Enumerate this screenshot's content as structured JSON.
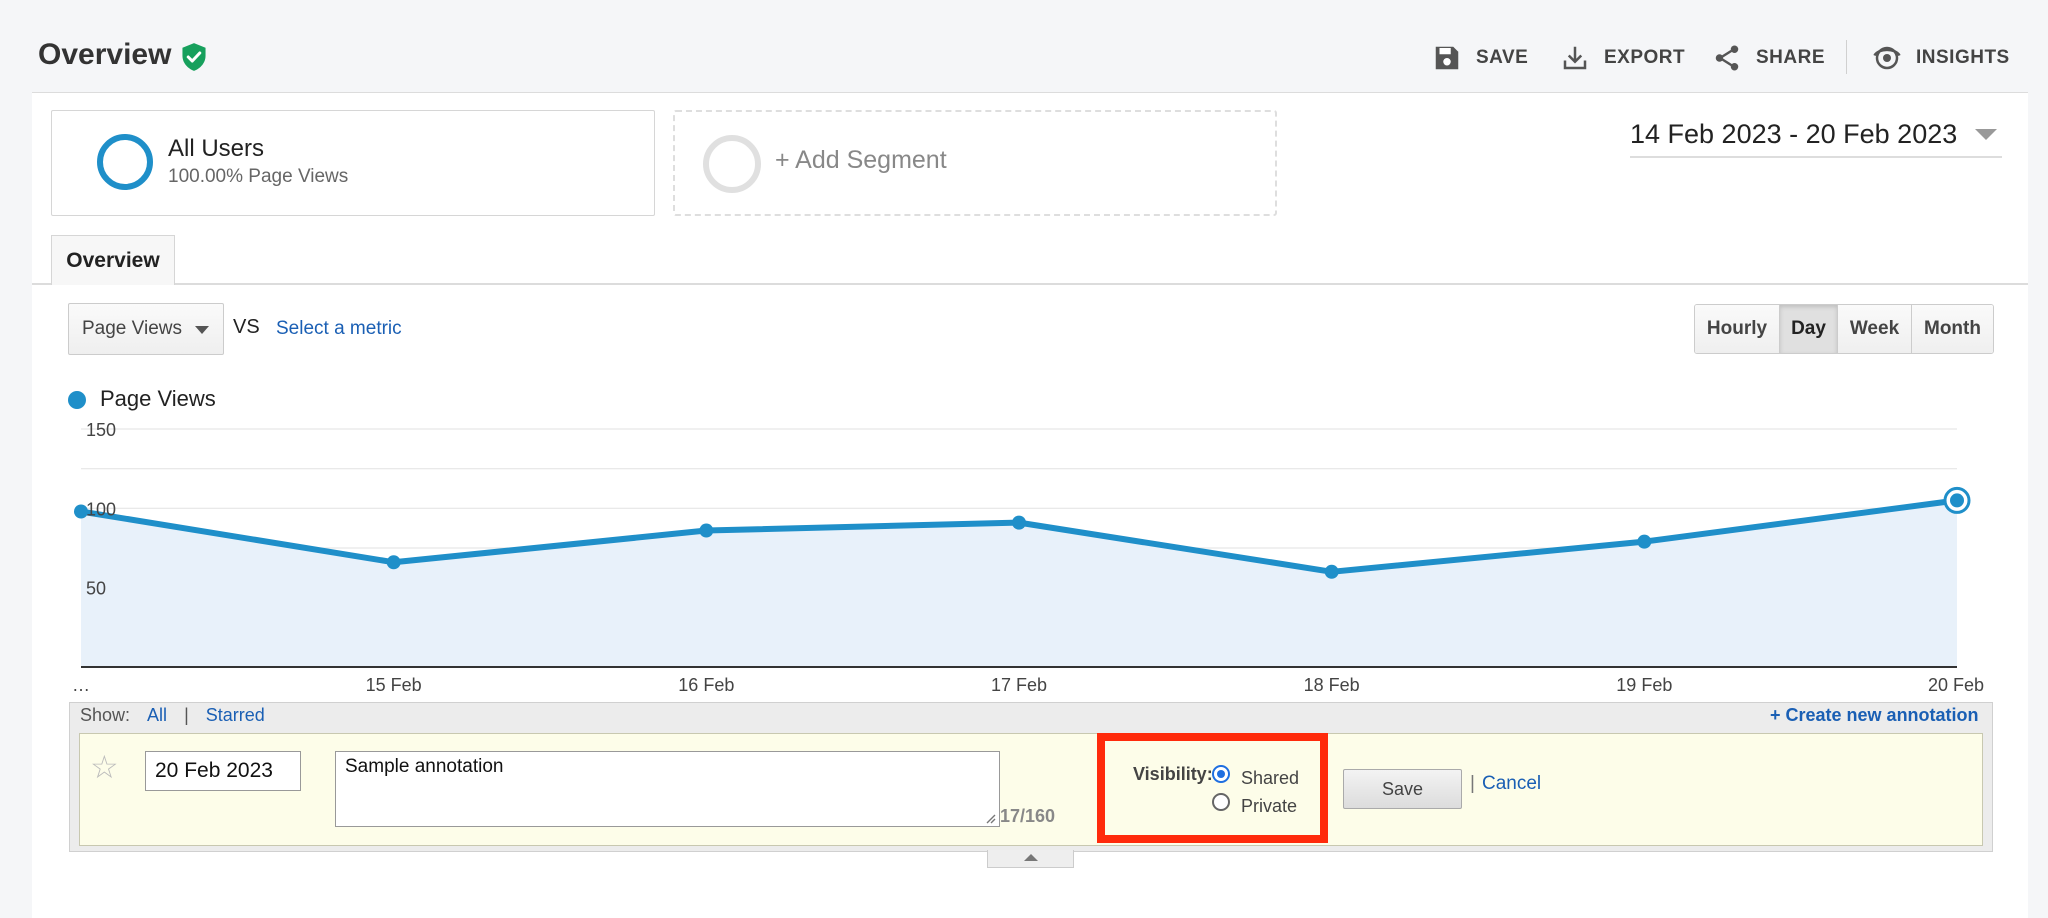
{
  "header": {
    "title": "Overview",
    "actions": {
      "save": "SAVE",
      "export": "EXPORT",
      "share": "SHARE",
      "insights": "INSIGHTS"
    }
  },
  "segments": {
    "active": {
      "name": "All Users",
      "detail": "100.00% Page Views"
    },
    "add_label": "+ Add Segment"
  },
  "date_range": "14 Feb 2023 - 20 Feb 2023",
  "tabs": {
    "overview": "Overview"
  },
  "metric": {
    "selected": "Page Views",
    "vs_label": "VS",
    "select_link": "Select a metric"
  },
  "granularity": {
    "hourly": "Hourly",
    "day": "Day",
    "week": "Week",
    "month": "Month",
    "active": "Day"
  },
  "legend": {
    "series": "Page Views"
  },
  "colors": {
    "series": "#1f8fc9",
    "area": "#e8f1fa",
    "link": "#1a5fb4",
    "highlight": "#ff2a0b",
    "verified": "#17a05d"
  },
  "chart_data": {
    "type": "area",
    "series": [
      {
        "name": "Page Views",
        "values": [
          98,
          66,
          86,
          91,
          60,
          79,
          105
        ]
      }
    ],
    "x": [
      "…",
      "15 Feb",
      "16 Feb",
      "17 Feb",
      "18 Feb",
      "19 Feb",
      "20 Feb"
    ],
    "y_ticks": [
      50,
      100,
      150
    ],
    "ylim": [
      0,
      150
    ],
    "grid": true
  },
  "annotations": {
    "show_label": "Show:",
    "show_all": "All",
    "show_sep": "|",
    "show_starred": "Starred",
    "create_link": "+ Create new annotation",
    "form": {
      "date": "20 Feb 2023",
      "text": "Sample annotation",
      "char_count": "17/160",
      "visibility_label": "Visibility:",
      "option_shared": "Shared",
      "option_private": "Private",
      "selected": "Shared",
      "save_label": "Save",
      "sep": "|",
      "cancel_label": "Cancel"
    }
  }
}
